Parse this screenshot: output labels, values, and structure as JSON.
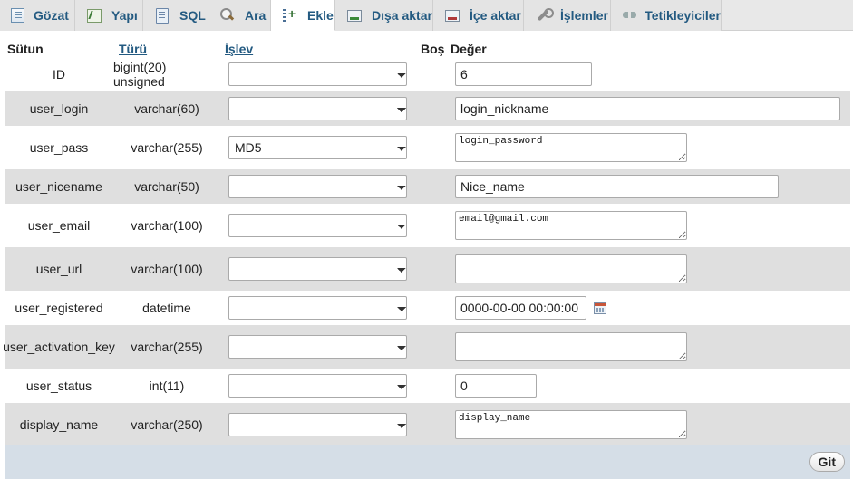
{
  "tabs": [
    {
      "label": "Gözat",
      "icon": "browse-icon",
      "active": false
    },
    {
      "label": "Yapı",
      "icon": "structure-icon",
      "active": false
    },
    {
      "label": "SQL",
      "icon": "sql-icon",
      "active": false
    },
    {
      "label": "Ara",
      "icon": "search-icon",
      "active": false
    },
    {
      "label": "Ekle",
      "icon": "insert-icon",
      "active": true
    },
    {
      "label": "Dışa aktar",
      "icon": "export-icon",
      "active": false
    },
    {
      "label": "İçe aktar",
      "icon": "import-icon",
      "active": false
    },
    {
      "label": "İşlemler",
      "icon": "operations-icon",
      "active": false
    },
    {
      "label": "Tetikleyiciler",
      "icon": "triggers-icon",
      "active": false
    }
  ],
  "headers": {
    "column": "Sütun",
    "type": "Türü",
    "function": "İşlev",
    "null": "Boş",
    "value": "Değer"
  },
  "rows": [
    {
      "name": "ID",
      "type": "bigint(20) unsigned",
      "function": "",
      "value": "6"
    },
    {
      "name": "user_login",
      "type": "varchar(60)",
      "function": "",
      "value": "login_nickname"
    },
    {
      "name": "user_pass",
      "type": "varchar(255)",
      "function": "MD5",
      "value": "login_password"
    },
    {
      "name": "user_nicename",
      "type": "varchar(50)",
      "function": "",
      "value": "Nice_name"
    },
    {
      "name": "user_email",
      "type": "varchar(100)",
      "function": "",
      "value": "email@gmail.com"
    },
    {
      "name": "user_url",
      "type": "varchar(100)",
      "function": "",
      "value": ""
    },
    {
      "name": "user_registered",
      "type": "datetime",
      "function": "",
      "value": "0000-00-00 00:00:00"
    },
    {
      "name": "user_activation_key",
      "type": "varchar(255)",
      "function": "",
      "value": ""
    },
    {
      "name": "user_status",
      "type": "int(11)",
      "function": "",
      "value": "0"
    },
    {
      "name": "display_name",
      "type": "varchar(250)",
      "function": "",
      "value": "display_name"
    }
  ],
  "footer": {
    "go_label": "Git"
  },
  "colors": {
    "tab_text": "#235a81",
    "row_alt": "#dfdfdf",
    "footer_bg": "#d5dee7"
  }
}
